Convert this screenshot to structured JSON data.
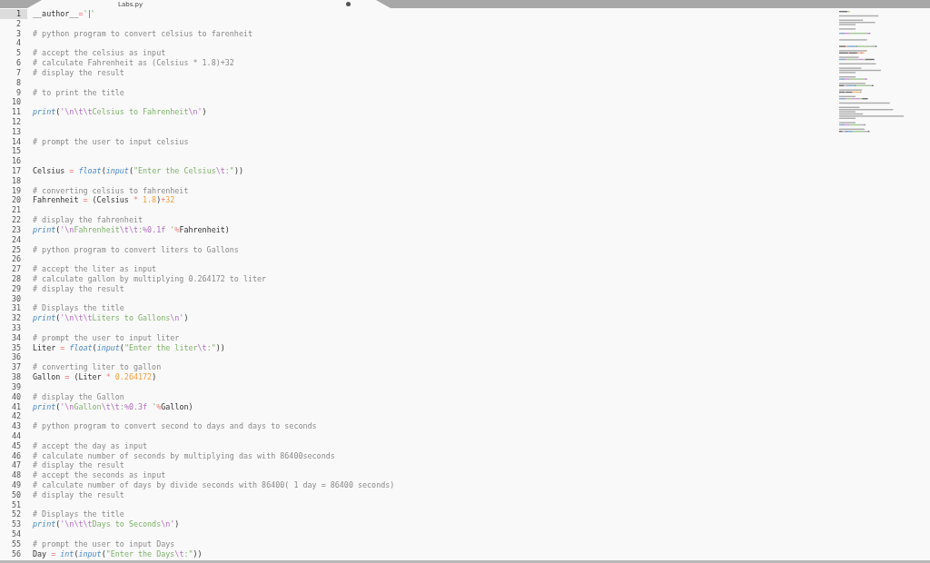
{
  "tab": {
    "title": "Labs.py",
    "selected": true
  },
  "lines": [
    {
      "number": "1",
      "current": true,
      "tokens": [
        {
          "kind": "plain",
          "text": "__author__"
        },
        {
          "kind": "op",
          "text": "="
        },
        {
          "kind": "string",
          "text": "'"
        },
        {
          "kind": "cursor"
        },
        {
          "kind": "string",
          "text": "'"
        }
      ]
    },
    {
      "number": "2",
      "current": false
    },
    {
      "number": "3",
      "current": false,
      "tokens": [
        {
          "kind": "comment",
          "text": "# python program to convert celsius to farenheit"
        }
      ]
    },
    {
      "number": "4",
      "current": false
    },
    {
      "number": "5",
      "current": false,
      "tokens": [
        {
          "kind": "comment",
          "text": "# accept the celsius as input"
        }
      ]
    },
    {
      "number": "6",
      "current": false,
      "tokens": [
        {
          "kind": "comment",
          "text": "# calculate Fahrenheit as (Celsius * 1.8)+32"
        }
      ]
    },
    {
      "number": "7",
      "current": false,
      "tokens": [
        {
          "kind": "comment",
          "text": "# display the result"
        }
      ]
    },
    {
      "number": "8",
      "current": false
    },
    {
      "number": "9",
      "current": false,
      "tokens": [
        {
          "kind": "comment",
          "text": "# to print the title"
        }
      ]
    },
    {
      "number": "10",
      "current": false
    },
    {
      "number": "11",
      "current": false,
      "tokens": [
        {
          "kind": "keyword",
          "text": "print"
        },
        {
          "kind": "plain",
          "text": "("
        },
        {
          "kind": "escape",
          "text": "'\\n\\t\\t"
        },
        {
          "kind": "string",
          "text": "Celsius to Fahrenheit"
        },
        {
          "kind": "escape",
          "text": "\\n'"
        },
        {
          "kind": "plain",
          "text": ")"
        }
      ]
    },
    {
      "number": "12",
      "current": false
    },
    {
      "number": "13",
      "current": false
    },
    {
      "number": "14",
      "current": false,
      "tokens": [
        {
          "kind": "comment",
          "text": "# prompt the user to input celsius"
        }
      ]
    },
    {
      "number": "15",
      "current": false
    },
    {
      "number": "16",
      "current": false
    },
    {
      "number": "17",
      "current": false,
      "tokens": [
        {
          "kind": "plain",
          "text": "Celsius "
        },
        {
          "kind": "op",
          "text": "= "
        },
        {
          "kind": "keyword",
          "text": "float"
        },
        {
          "kind": "plain",
          "text": "("
        },
        {
          "kind": "keyword",
          "text": "input"
        },
        {
          "kind": "plain",
          "text": "("
        },
        {
          "kind": "string",
          "text": "\"Enter the Celsius"
        },
        {
          "kind": "escape",
          "text": "\\t"
        },
        {
          "kind": "string",
          "text": ":\""
        },
        {
          "kind": "plain",
          "text": "))"
        }
      ]
    },
    {
      "number": "18",
      "current": false
    },
    {
      "number": "19",
      "current": false,
      "tokens": [
        {
          "kind": "comment",
          "text": "# converting celsius to fahrenheit"
        }
      ]
    },
    {
      "number": "20",
      "current": false,
      "tokens": [
        {
          "kind": "plain",
          "text": "Fahrenheit "
        },
        {
          "kind": "op",
          "text": "="
        },
        {
          "kind": "plain",
          "text": " (Celsius "
        },
        {
          "kind": "op",
          "text": "* "
        },
        {
          "kind": "number",
          "text": "1.8"
        },
        {
          "kind": "plain",
          "text": ")"
        },
        {
          "kind": "op",
          "text": "+"
        },
        {
          "kind": "number",
          "text": "32"
        }
      ]
    },
    {
      "number": "21",
      "current": false
    },
    {
      "number": "22",
      "current": false,
      "tokens": [
        {
          "kind": "comment",
          "text": "# display the fahrenheit"
        }
      ]
    },
    {
      "number": "23",
      "current": false,
      "tokens": [
        {
          "kind": "keyword",
          "text": "print"
        },
        {
          "kind": "plain",
          "text": "("
        },
        {
          "kind": "escape",
          "text": "'\\n"
        },
        {
          "kind": "string",
          "text": "Fahrenheit"
        },
        {
          "kind": "escape",
          "text": "\\t\\t"
        },
        {
          "kind": "string",
          "text": ":"
        },
        {
          "kind": "escape",
          "text": "%0.1f"
        },
        {
          "kind": "string",
          "text": " '"
        },
        {
          "kind": "op",
          "text": "%"
        },
        {
          "kind": "plain",
          "text": "Fahrenheit)"
        }
      ]
    },
    {
      "number": "24",
      "current": false
    },
    {
      "number": "25",
      "current": false,
      "tokens": [
        {
          "kind": "comment",
          "text": "# python program to convert liters to Gallons"
        }
      ]
    },
    {
      "number": "26",
      "current": false
    },
    {
      "number": "27",
      "current": false,
      "tokens": [
        {
          "kind": "comment",
          "text": "# accept the liter as input"
        }
      ]
    },
    {
      "number": "28",
      "current": false,
      "tokens": [
        {
          "kind": "comment",
          "text": "# calculate gallon by multiplying 0.264172 to liter"
        }
      ]
    },
    {
      "number": "29",
      "current": false,
      "tokens": [
        {
          "kind": "comment",
          "text": "# display the result"
        }
      ]
    },
    {
      "number": "30",
      "current": false
    },
    {
      "number": "31",
      "current": false,
      "tokens": [
        {
          "kind": "comment",
          "text": "# Displays the title"
        }
      ]
    },
    {
      "number": "32",
      "current": false,
      "tokens": [
        {
          "kind": "keyword",
          "text": "print"
        },
        {
          "kind": "plain",
          "text": "("
        },
        {
          "kind": "escape",
          "text": "'\\n\\t\\t"
        },
        {
          "kind": "string",
          "text": "Liters to Gallons"
        },
        {
          "kind": "escape",
          "text": "\\n'"
        },
        {
          "kind": "plain",
          "text": ")"
        }
      ]
    },
    {
      "number": "33",
      "current": false
    },
    {
      "number": "34",
      "current": false,
      "tokens": [
        {
          "kind": "comment",
          "text": "# prompt the user to input liter"
        }
      ]
    },
    {
      "number": "35",
      "current": false,
      "tokens": [
        {
          "kind": "plain",
          "text": "Liter "
        },
        {
          "kind": "op",
          "text": "= "
        },
        {
          "kind": "keyword",
          "text": "float"
        },
        {
          "kind": "plain",
          "text": "("
        },
        {
          "kind": "keyword",
          "text": "input"
        },
        {
          "kind": "plain",
          "text": "("
        },
        {
          "kind": "string",
          "text": "\"Enter the liter"
        },
        {
          "kind": "escape",
          "text": "\\t"
        },
        {
          "kind": "string",
          "text": ":\""
        },
        {
          "kind": "plain",
          "text": "))"
        }
      ]
    },
    {
      "number": "36",
      "current": false
    },
    {
      "number": "37",
      "current": false,
      "tokens": [
        {
          "kind": "comment",
          "text": "# converting liter to gallon"
        }
      ]
    },
    {
      "number": "38",
      "current": false,
      "tokens": [
        {
          "kind": "plain",
          "text": "Gallon "
        },
        {
          "kind": "op",
          "text": "="
        },
        {
          "kind": "plain",
          "text": " (Liter "
        },
        {
          "kind": "op",
          "text": "* "
        },
        {
          "kind": "number",
          "text": "0.264172"
        },
        {
          "kind": "plain",
          "text": ")"
        }
      ]
    },
    {
      "number": "39",
      "current": false
    },
    {
      "number": "40",
      "current": false,
      "tokens": [
        {
          "kind": "comment",
          "text": "# display the Gallon"
        }
      ]
    },
    {
      "number": "41",
      "current": false,
      "tokens": [
        {
          "kind": "keyword",
          "text": "print"
        },
        {
          "kind": "plain",
          "text": "("
        },
        {
          "kind": "escape",
          "text": "'\\n"
        },
        {
          "kind": "string",
          "text": "Gallon"
        },
        {
          "kind": "escape",
          "text": "\\t\\t"
        },
        {
          "kind": "string",
          "text": ":"
        },
        {
          "kind": "escape",
          "text": "%0.3f"
        },
        {
          "kind": "string",
          "text": " '"
        },
        {
          "kind": "op",
          "text": "%"
        },
        {
          "kind": "plain",
          "text": "Gallon)"
        }
      ]
    },
    {
      "number": "42",
      "current": false
    },
    {
      "number": "43",
      "current": false,
      "tokens": [
        {
          "kind": "comment",
          "text": "# python program to convert second to days and days to seconds"
        }
      ]
    },
    {
      "number": "44",
      "current": false
    },
    {
      "number": "45",
      "current": false,
      "tokens": [
        {
          "kind": "comment",
          "text": "# accept the day as input"
        }
      ]
    },
    {
      "number": "46",
      "current": false,
      "tokens": [
        {
          "kind": "comment",
          "text": "# calculate number of seconds by multiplying das with 86400seconds"
        }
      ]
    },
    {
      "number": "47",
      "current": false,
      "tokens": [
        {
          "kind": "comment",
          "text": "# display the result"
        }
      ]
    },
    {
      "number": "48",
      "current": false,
      "tokens": [
        {
          "kind": "comment",
          "text": "# accept the seconds as input"
        }
      ]
    },
    {
      "number": "49",
      "current": false,
      "tokens": [
        {
          "kind": "comment",
          "text": "# calculate number of days by divide seconds with 86400( 1 day = 86400 seconds)"
        }
      ]
    },
    {
      "number": "50",
      "current": false,
      "tokens": [
        {
          "kind": "comment",
          "text": "# display the result"
        }
      ]
    },
    {
      "number": "51",
      "current": false
    },
    {
      "number": "52",
      "current": false,
      "tokens": [
        {
          "kind": "comment",
          "text": "# Displays the title"
        }
      ]
    },
    {
      "number": "53",
      "current": false,
      "tokens": [
        {
          "kind": "keyword",
          "text": "print"
        },
        {
          "kind": "plain",
          "text": "("
        },
        {
          "kind": "escape",
          "text": "'\\n\\t\\t"
        },
        {
          "kind": "string",
          "text": "Days to Seconds"
        },
        {
          "kind": "escape",
          "text": "\\n'"
        },
        {
          "kind": "plain",
          "text": ")"
        }
      ]
    },
    {
      "number": "54",
      "current": false
    },
    {
      "number": "55",
      "current": false,
      "tokens": [
        {
          "kind": "comment",
          "text": "# prompt the user to input Days"
        }
      ]
    },
    {
      "number": "56",
      "current": false,
      "tokens": [
        {
          "kind": "plain",
          "text": "Day "
        },
        {
          "kind": "op",
          "text": "= "
        },
        {
          "kind": "keyword",
          "text": "int"
        },
        {
          "kind": "plain",
          "text": "("
        },
        {
          "kind": "keyword",
          "text": "input"
        },
        {
          "kind": "plain",
          "text": "("
        },
        {
          "kind": "string",
          "text": "\"Enter the Days"
        },
        {
          "kind": "escape",
          "text": "\\t"
        },
        {
          "kind": "string",
          "text": ":\""
        },
        {
          "kind": "plain",
          "text": "))"
        }
      ]
    }
  ]
}
